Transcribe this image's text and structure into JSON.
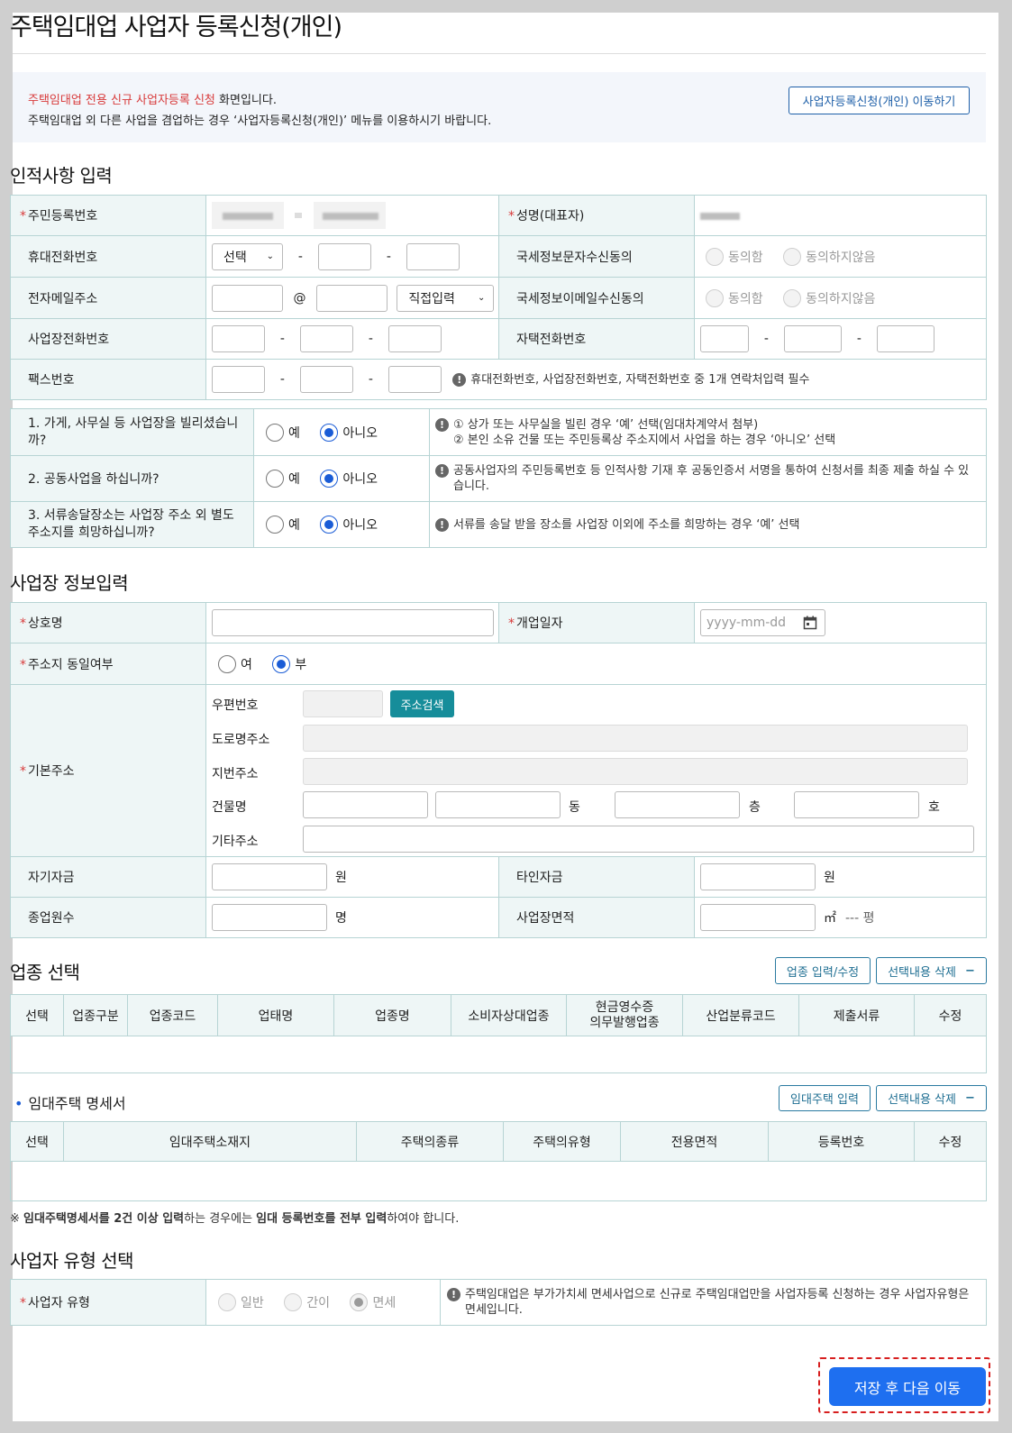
{
  "page": {
    "title": "주택임대업 사업자 등록신청(개인)",
    "notice": {
      "line1_highlight": "주택임대업 전용 신규 사업자등록 신청",
      "line1_rest": " 화면입니다.",
      "line2": "주택임대업 외 다른 사업을 겸업하는 경우 ‘사업자등록신청(개인)’ 메뉴를 이용하시기 바랍니다.",
      "goto_button": "사업자등록신청(개인) 이동하기"
    }
  },
  "personal": {
    "heading": "인적사항 입력",
    "labels": {
      "rrn": "주민등록번호",
      "name": "성명(대표자)",
      "mobile": "휴대전화번호",
      "nts_sms_consent": "국세정보문자수신동의",
      "email": "전자메일주소",
      "nts_email_consent": "국세정보이메일수신동의",
      "biz_phone": "사업장전화번호",
      "home_phone": "자택전화번호",
      "fax": "팩스번호"
    },
    "mobile_select": "선택",
    "email_at": "@",
    "email_domain_select": "직접입력",
    "dash": "-",
    "consent_yes": "동의함",
    "consent_no": "동의하지않음",
    "contact_note": "휴대전화번호, 사업장전화번호, 자택전화번호 중 1개 연락처입력 필수"
  },
  "questions": [
    {
      "q": "1. 가게, 사무실 등 사업장을 빌리셨습니까?",
      "yes": "예",
      "no": "아니오",
      "selected": "아니오",
      "note1": "① 상가 또는 사무실을 빌린 경우 ‘예’ 선택(임대차계약서 첨부)",
      "note2": "② 본인 소유 건물 또는 주민등록상 주소지에서 사업을 하는 경우 ‘아니오’ 선택"
    },
    {
      "q": "2. 공동사업을 하십니까?",
      "yes": "예",
      "no": "아니오",
      "selected": "아니오",
      "note1": "공동사업자의 주민등록번호 등 인적사항 기재 후 공동인증서 서명을 통하여 신청서를 최종 제출 하실 수 있습니다.",
      "note2": ""
    },
    {
      "q": "3. 서류송달장소는 사업장 주소 외 별도 주소지를 희망하십니까?",
      "yes": "예",
      "no": "아니오",
      "selected": "아니오",
      "note1": "서류를 송달 받을 장소를 사업장 이외에 주소를 희망하는 경우 ‘예’ 선택",
      "note2": ""
    }
  ],
  "business": {
    "heading": "사업장 정보입력",
    "labels": {
      "trade_name": "상호명",
      "open_date": "개업일자",
      "same_address": "주소지 동일여부",
      "base_address": "기본주소",
      "own_funds": "자기자금",
      "other_funds": "타인자금",
      "employees": "종업원수",
      "area": "사업장면적"
    },
    "open_date_placeholder": "yyyy-mm-dd",
    "same_yes": "여",
    "same_no": "부",
    "same_selected": "부",
    "addr": {
      "postcode": "우편번호",
      "search_button": "주소검색",
      "road": "도로명주소",
      "lot": "지번주소",
      "building": "건물명",
      "dong": "동",
      "floor": "층",
      "ho": "호",
      "etc": "기타주소"
    },
    "won": "원",
    "persons": "명",
    "sqm": "㎡",
    "pyeong": "--- 평"
  },
  "industry": {
    "heading": "업종 선택",
    "btn_edit": "업종 입력/수정",
    "btn_delete": "선택내용 삭제",
    "columns": [
      "선택",
      "업종구분",
      "업종코드",
      "업태명",
      "업종명",
      "소비자상대업종",
      "현금영수증\n의무발행업종",
      "산업분류코드",
      "제출서류",
      "수정"
    ]
  },
  "rental": {
    "heading": "임대주택 명세서",
    "btn_input": "임대주택 입력",
    "btn_delete": "선택내용 삭제",
    "columns": [
      "선택",
      "임대주택소재지",
      "주택의종류",
      "주택의유형",
      "전용면적",
      "등록번호",
      "수정"
    ],
    "footnote_1": "※ ",
    "footnote_b1": "임대주택명세서를 2건 이상 입력",
    "footnote_2": "하는 경우에는 ",
    "footnote_b2": "임대 등록번호를 전부 입력",
    "footnote_3": "하여야 합니다."
  },
  "biztype": {
    "heading": "사업자 유형 선택",
    "label": "사업자 유형",
    "opt1": "일반",
    "opt2": "간이",
    "opt3": "면세",
    "selected": "면세",
    "note": "주택임대업은 부가가치세 면세사업으로 신규로 주택임대업만을 사업자등록 신청하는 경우 사업자유형은 면세입니다."
  },
  "footer": {
    "save_button": "저장 후 다음 이동"
  },
  "colors": {
    "accent": "#1e6ff0",
    "teal": "#168d9a",
    "required": "#d83b3b",
    "label_bg": "#eef6f6"
  }
}
